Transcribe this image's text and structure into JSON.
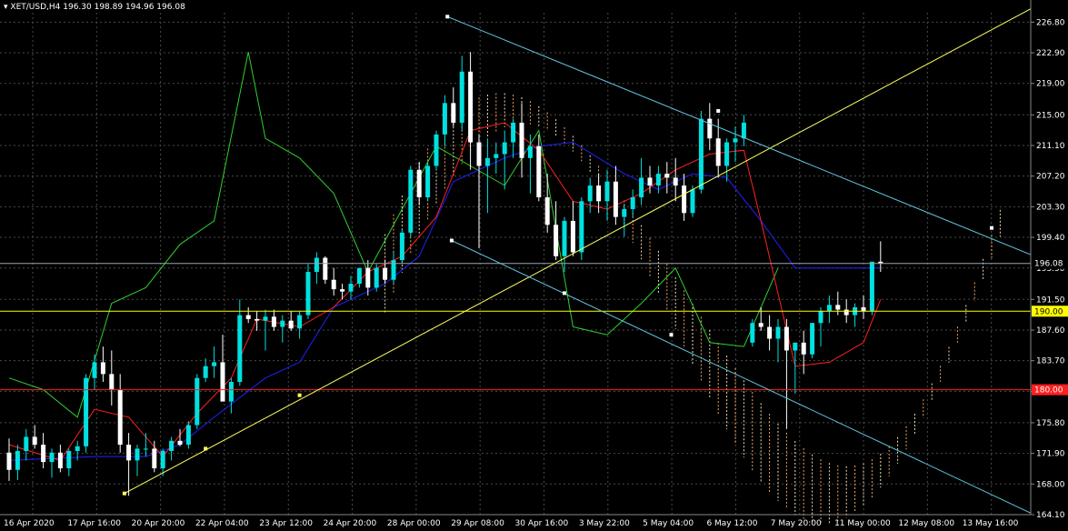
{
  "header": {
    "symbol": "XET/USD,H4",
    "ohlc": "196.30 198.89 194.96 196.08"
  },
  "colors": {
    "background": "#000000",
    "grid": "#4a4a4a",
    "bull": "#00e0e0",
    "bear": "#ffffff",
    "tenkan": "#ff2020",
    "kijun": "#2020ff",
    "chikou": "#30d030",
    "cloud_a": "#f4a460",
    "cloud_b": "#f5deb3",
    "trend_yellow": "#ffff60",
    "channel_cyan": "#60c8e0",
    "hline_yellow": "#ffff00",
    "hline_red": "#ff2020"
  },
  "chart_data": {
    "type": "candlestick",
    "ylim": [
      164.1,
      228.0
    ],
    "y_ticks": [
      "226.80",
      "222.90",
      "219.00",
      "215.00",
      "211.10",
      "207.20",
      "203.30",
      "199.40",
      "195.50",
      "191.50",
      "187.60",
      "183.70",
      "179.80",
      "175.80",
      "171.90",
      "168.00",
      "164.10"
    ],
    "x_ticks": [
      "16 Apr 2020",
      "17 Apr 16:00",
      "20 Apr 20:00",
      "22 Apr 04:00",
      "23 Apr 12:00",
      "24 Apr 20:00",
      "28 Apr 00:00",
      "29 Apr 08:00",
      "30 Apr 16:00",
      "3 May 22:00",
      "5 May 04:00",
      "6 May 12:00",
      "7 May 20:00",
      "11 May 00:00",
      "12 May 08:00",
      "13 May 16:00"
    ],
    "current_price_label": "196.08",
    "current_price": 196.08,
    "hline_yellow_label": "190.00",
    "hline_yellow": 190.0,
    "hline_red_label": "180.00",
    "hline_red": 180.0,
    "candles": [
      [
        172.0,
        173.8,
        168.4,
        169.8
      ],
      [
        169.8,
        173.0,
        168.5,
        172.2
      ],
      [
        172.2,
        175.0,
        171.0,
        174.0
      ],
      [
        174.0,
        175.5,
        172.5,
        173.0
      ],
      [
        173.0,
        174.5,
        170.0,
        170.8
      ],
      [
        170.8,
        172.5,
        168.8,
        172.0
      ],
      [
        172.0,
        173.0,
        169.5,
        170.0
      ],
      [
        170.0,
        172.5,
        169.0,
        172.2
      ],
      [
        172.2,
        173.5,
        171.0,
        172.8
      ],
      [
        172.8,
        182.0,
        172.0,
        181.5
      ],
      [
        181.5,
        184.5,
        180.0,
        183.5
      ],
      [
        183.5,
        185.5,
        181.0,
        182.0
      ],
      [
        182.0,
        185.0,
        178.0,
        180.0
      ],
      [
        180.0,
        182.0,
        172.0,
        173.0
      ],
      [
        173.0,
        174.5,
        166.5,
        171.0
      ],
      [
        171.0,
        173.0,
        169.0,
        172.5
      ],
      [
        172.5,
        174.5,
        171.5,
        172.5
      ],
      [
        172.5,
        173.5,
        169.5,
        170.0
      ],
      [
        170.0,
        172.5,
        169.0,
        172.2
      ],
      [
        172.2,
        174.0,
        171.0,
        173.5
      ],
      [
        173.5,
        175.0,
        172.8,
        173.0
      ],
      [
        173.0,
        176.0,
        172.5,
        175.5
      ],
      [
        175.5,
        182.0,
        175.0,
        181.5
      ],
      [
        181.5,
        184.0,
        181.0,
        183.0
      ],
      [
        183.0,
        185.5,
        181.5,
        183.5
      ],
      [
        183.5,
        187.0,
        182.0,
        178.5
      ],
      [
        178.5,
        181.5,
        177.0,
        181.0
      ],
      [
        181.0,
        191.5,
        180.5,
        189.5
      ],
      [
        189.5,
        190.5,
        188.5,
        189.0
      ],
      [
        189.0,
        190.0,
        187.5,
        188.8
      ],
      [
        188.8,
        190.2,
        185.0,
        189.3
      ],
      [
        189.3,
        190.2,
        187.5,
        188.0
      ],
      [
        188.0,
        189.5,
        186.0,
        188.8
      ],
      [
        188.8,
        190.0,
        187.5,
        187.8
      ],
      [
        187.8,
        190.0,
        186.5,
        189.5
      ],
      [
        189.5,
        196.0,
        189.0,
        195.0
      ],
      [
        195.0,
        197.5,
        193.5,
        196.8
      ],
      [
        196.8,
        197.0,
        193.5,
        194.0
      ],
      [
        194.0,
        195.5,
        192.0,
        192.8
      ],
      [
        192.8,
        193.5,
        191.5,
        192.5
      ],
      [
        192.5,
        194.5,
        191.5,
        193.5
      ],
      [
        193.5,
        195.5,
        193.0,
        195.5
      ],
      [
        195.5,
        196.5,
        192.0,
        193.0
      ],
      [
        193.0,
        196.0,
        192.5,
        195.5
      ],
      [
        195.5,
        196.5,
        193.5,
        194.0
      ],
      [
        194.0,
        197.5,
        193.5,
        196.5
      ],
      [
        196.5,
        200.5,
        196.0,
        200.0
      ],
      [
        200.0,
        208.5,
        199.5,
        208.0
      ],
      [
        208.0,
        209.0,
        203.5,
        204.5
      ],
      [
        204.5,
        209.0,
        204.0,
        208.5
      ],
      [
        208.5,
        213.0,
        208.0,
        212.5
      ],
      [
        212.5,
        217.5,
        211.0,
        216.5
      ],
      [
        216.5,
        218.5,
        213.5,
        214.0
      ],
      [
        214.0,
        222.5,
        213.0,
        220.5
      ],
      [
        220.5,
        223.0,
        208.0,
        211.5
      ],
      [
        211.5,
        212.5,
        198.0,
        208.5
      ],
      [
        208.5,
        212.0,
        202.5,
        209.5
      ],
      [
        209.5,
        211.5,
        207.5,
        210.0
      ],
      [
        210.0,
        213.0,
        205.5,
        211.5
      ],
      [
        211.5,
        214.5,
        209.5,
        214.0
      ],
      [
        214.0,
        216.5,
        207.0,
        209.5
      ],
      [
        209.5,
        212.5,
        205.0,
        211.0
      ],
      [
        211.0,
        212.5,
        204.0,
        204.5
      ],
      [
        204.5,
        207.5,
        200.0,
        201.0
      ],
      [
        201.0,
        204.0,
        196.5,
        197.0
      ],
      [
        197.0,
        202.0,
        195.0,
        201.5
      ],
      [
        201.5,
        204.0,
        197.0,
        197.5
      ],
      [
        197.5,
        204.5,
        196.5,
        204.0
      ],
      [
        204.0,
        207.0,
        202.5,
        206.0
      ],
      [
        206.0,
        207.5,
        202.5,
        204.0
      ],
      [
        204.0,
        208.0,
        201.5,
        206.5
      ],
      [
        206.5,
        208.5,
        201.0,
        202.0
      ],
      [
        202.0,
        203.5,
        199.5,
        203.0
      ],
      [
        203.0,
        205.5,
        202.0,
        204.5
      ],
      [
        204.5,
        209.5,
        203.5,
        207.0
      ],
      [
        207.0,
        208.5,
        205.0,
        206.0
      ],
      [
        206.0,
        208.5,
        205.0,
        207.5
      ],
      [
        207.5,
        209.0,
        205.0,
        207.0
      ],
      [
        207.0,
        209.5,
        204.0,
        206.0
      ],
      [
        206.0,
        207.5,
        201.5,
        202.5
      ],
      [
        202.5,
        206.0,
        202.0,
        205.5
      ],
      [
        205.5,
        215.5,
        205.0,
        214.5
      ],
      [
        214.5,
        216.5,
        210.5,
        212.0
      ],
      [
        212.0,
        214.5,
        207.0,
        208.5
      ],
      [
        208.5,
        212.0,
        206.5,
        211.5
      ],
      [
        211.5,
        213.5,
        209.0,
        212.0
      ],
      [
        212.0,
        215.0,
        211.0,
        214.0
      ],
      [
        186.0,
        189.0,
        185.5,
        188.5
      ],
      [
        188.5,
        190.5,
        187.5,
        188.0
      ],
      [
        188.0,
        189.5,
        185.0,
        186.5
      ],
      [
        186.5,
        189.0,
        183.5,
        188.0
      ],
      [
        188.0,
        189.0,
        175.0,
        185.0
      ],
      [
        185.0,
        186.0,
        179.5,
        186.0
      ],
      [
        186.0,
        187.5,
        182.0,
        184.5
      ],
      [
        184.5,
        188.5,
        184.0,
        188.5
      ],
      [
        188.5,
        190.5,
        185.5,
        190.0
      ],
      [
        190.0,
        192.0,
        188.5,
        190.8
      ],
      [
        190.8,
        192.5,
        189.5,
        190.2
      ],
      [
        190.2,
        191.5,
        188.5,
        189.5
      ],
      [
        189.5,
        191.0,
        188.0,
        190.5
      ],
      [
        190.5,
        192.0,
        189.0,
        190.0
      ],
      [
        190.0,
        196.3,
        189.5,
        196.3
      ],
      [
        196.3,
        198.9,
        195.0,
        196.1
      ]
    ],
    "tenkan": [
      [
        0,
        173.0
      ],
      [
        6,
        171.0
      ],
      [
        10,
        177.5
      ],
      [
        14,
        176.5
      ],
      [
        18,
        171.5
      ],
      [
        22,
        177.0
      ],
      [
        26,
        181.5
      ],
      [
        29,
        189.0
      ],
      [
        34,
        188.0
      ],
      [
        38,
        190.5
      ],
      [
        42,
        195.0
      ],
      [
        46,
        197.0
      ],
      [
        50,
        202.0
      ],
      [
        54,
        213.0
      ],
      [
        58,
        214.0
      ],
      [
        62,
        210.5
      ],
      [
        66,
        204.0
      ],
      [
        70,
        203.0
      ],
      [
        74,
        205.0
      ],
      [
        78,
        208.0
      ],
      [
        82,
        210.0
      ],
      [
        86,
        210.5
      ],
      [
        88,
        201.5
      ],
      [
        92,
        183.0
      ],
      [
        96,
        183.5
      ],
      [
        100,
        186.0
      ],
      [
        102,
        191.5
      ]
    ],
    "kijun": [
      [
        0,
        171.0
      ],
      [
        10,
        171.5
      ],
      [
        16,
        171.5
      ],
      [
        20,
        173.0
      ],
      [
        24,
        176.5
      ],
      [
        30,
        181.5
      ],
      [
        34,
        183.5
      ],
      [
        38,
        190.5
      ],
      [
        44,
        193.5
      ],
      [
        48,
        197.0
      ],
      [
        52,
        206.5
      ],
      [
        58,
        209.5
      ],
      [
        62,
        211.0
      ],
      [
        66,
        211.5
      ],
      [
        72,
        207.5
      ],
      [
        76,
        205.5
      ],
      [
        80,
        207.5
      ],
      [
        84,
        207.0
      ],
      [
        88,
        201.5
      ],
      [
        92,
        195.5
      ],
      [
        96,
        195.5
      ],
      [
        102,
        195.5
      ]
    ],
    "chikou": [
      [
        0,
        181.5
      ],
      [
        4,
        180.0
      ],
      [
        8,
        176.5
      ],
      [
        12,
        191.0
      ],
      [
        16,
        193.0
      ],
      [
        20,
        198.5
      ],
      [
        24,
        201.5
      ],
      [
        28,
        223.0
      ],
      [
        30,
        212.0
      ],
      [
        34,
        209.5
      ],
      [
        38,
        205.0
      ],
      [
        42,
        195.0
      ],
      [
        46,
        203.0
      ],
      [
        50,
        211.0
      ],
      [
        54,
        208.5
      ],
      [
        58,
        206.0
      ],
      [
        62,
        213.0
      ],
      [
        66,
        188.0
      ],
      [
        70,
        187.0
      ],
      [
        74,
        191.0
      ],
      [
        78,
        195.5
      ],
      [
        82,
        186.0
      ],
      [
        86,
        185.5
      ],
      [
        90,
        195.5
      ]
    ]
  }
}
